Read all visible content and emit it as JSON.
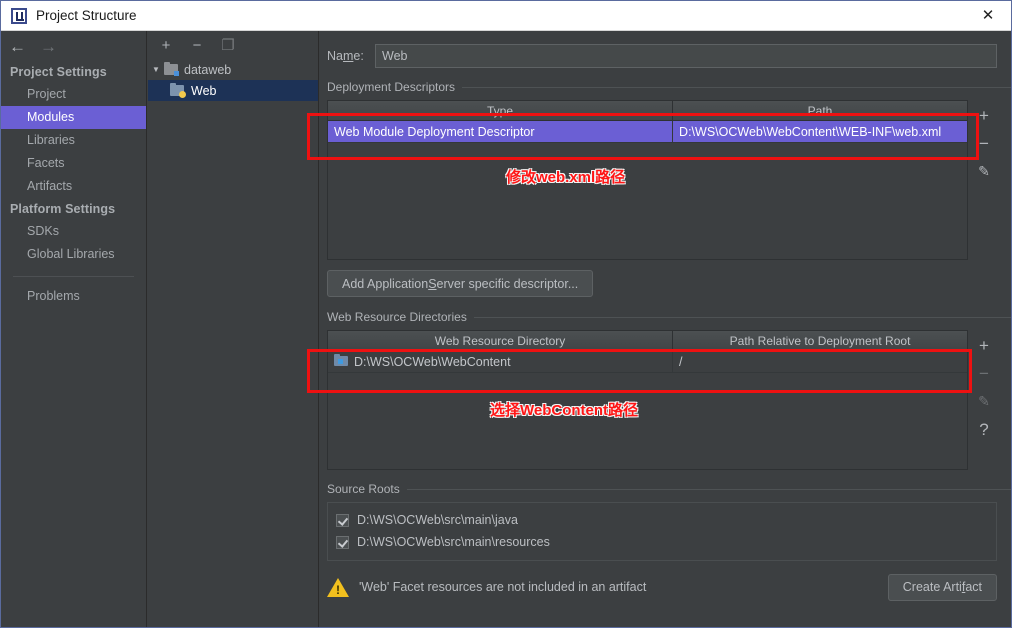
{
  "window": {
    "title": "Project Structure",
    "app_icon": "intellij-idea-icon",
    "close_label": "✕"
  },
  "nav": {
    "back_icon": "←",
    "forward_icon": "→"
  },
  "sidebar": {
    "groups": [
      {
        "label": "Project Settings",
        "items": [
          {
            "label": "Project",
            "selected": false
          },
          {
            "label": "Modules",
            "selected": true
          },
          {
            "label": "Libraries",
            "selected": false
          },
          {
            "label": "Facets",
            "selected": false
          },
          {
            "label": "Artifacts",
            "selected": false
          }
        ]
      },
      {
        "label": "Platform Settings",
        "items": [
          {
            "label": "SDKs",
            "selected": false
          },
          {
            "label": "Global Libraries",
            "selected": false
          }
        ]
      }
    ],
    "problems_label": "Problems",
    "selected_color": "#6b5fd4"
  },
  "tree": {
    "toolbar": {
      "add_icon": "+",
      "remove_icon": "−",
      "copy_icon": "❐"
    },
    "caret": "▼",
    "nodes": [
      {
        "label": "dataweb",
        "icon": "module-folder-icon",
        "selected": false
      },
      {
        "label": "Web",
        "icon": "web-facet-icon",
        "selected": true
      }
    ]
  },
  "main": {
    "name_field": {
      "label_before": "Na",
      "label_mnemonic": "m",
      "label_after": "e:",
      "value": "Web",
      "placeholder": ""
    },
    "deployment_descriptors": {
      "title": "Deployment Descriptors",
      "columns": [
        "Type",
        "Path"
      ],
      "rows": [
        {
          "type": "Web Module Deployment Descriptor",
          "path": "D:\\WS\\OCWeb\\WebContent\\WEB-INF\\web.xml",
          "selected": true
        }
      ],
      "buttons": [
        {
          "name": "add-descriptor-button",
          "glyph": "+",
          "enabled": true
        },
        {
          "name": "remove-descriptor-button",
          "glyph": "−",
          "enabled": true
        },
        {
          "name": "edit-descriptor-button",
          "glyph": "✎",
          "enabled": true
        }
      ]
    },
    "add_descriptor_button": {
      "before": "Add Application ",
      "mnemonic": "S",
      "after": "erver specific descriptor..."
    },
    "web_resource_directories": {
      "title": "Web Resource Directories",
      "columns": [
        "Web Resource Directory",
        "Path Relative to Deployment Root"
      ],
      "rows": [
        {
          "directory": "D:\\WS\\OCWeb\\WebContent",
          "relative_path": "/",
          "icon": "folder-icon",
          "selected": false
        }
      ],
      "buttons": [
        {
          "name": "add-resource-dir-button",
          "glyph": "+",
          "enabled": true
        },
        {
          "name": "remove-resource-dir-button",
          "glyph": "−",
          "enabled": false
        },
        {
          "name": "edit-resource-dir-button",
          "glyph": "✎",
          "enabled": false
        },
        {
          "name": "help-resource-dir-button",
          "glyph": "?",
          "enabled": true
        }
      ]
    },
    "source_roots": {
      "title": "Source Roots",
      "items": [
        {
          "label": "D:\\WS\\OCWeb\\src\\main\\java",
          "checked": true
        },
        {
          "label": "D:\\WS\\OCWeb\\src\\main\\resources",
          "checked": true
        }
      ]
    },
    "footer": {
      "warning_icon": "warning-icon",
      "warning_text": "'Web' Facet resources are not included in an artifact",
      "create_artifact": {
        "before": "Create Arti",
        "mnemonic": "f",
        "after": "act"
      }
    }
  },
  "annotations": {
    "color": "#ff1616",
    "items": [
      {
        "text": "修改web.xml路径"
      },
      {
        "text": "选择WebContent路径"
      }
    ]
  }
}
